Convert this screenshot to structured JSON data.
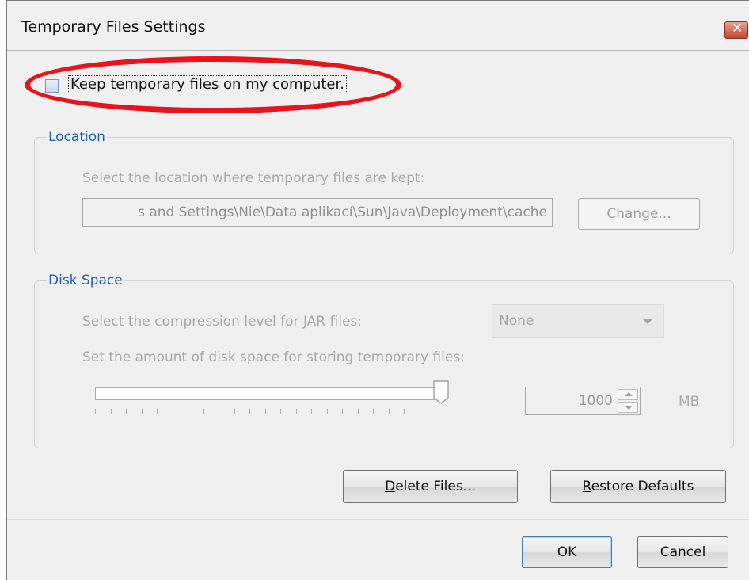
{
  "window": {
    "title": "Temporary Files Settings",
    "close_glyph": "✕"
  },
  "keep_files": {
    "checked": false,
    "label_first": "K",
    "label_rest": "eep temporary files on my computer."
  },
  "location": {
    "legend": "Location",
    "description": "Select the location where temporary files are kept:",
    "path_value": "s and Settings\\Nie\\Data aplikací\\Sun\\Java\\Deployment\\cache",
    "change_label_pre": "C",
    "change_label_u": "h",
    "change_label_post": "ange..."
  },
  "disk_space": {
    "legend": "Disk Space",
    "compression_label": "Select the compression level for JAR files:",
    "compression_value": "None",
    "amount_label": "Set the amount of disk space for storing temporary files:",
    "slider_position": 1.0,
    "spin_value": "1000",
    "unit": "MB"
  },
  "actions": {
    "delete_label_u": "D",
    "delete_label_rest": "elete Files...",
    "restore_label_u": "R",
    "restore_label_rest": "estore Defaults",
    "ok_label": "OK",
    "cancel_label": "Cancel"
  },
  "colors": {
    "accent_legend": "#1c5fbf",
    "highlight_ring": "#e8141b",
    "disabled_text": "#a9a9a9"
  }
}
